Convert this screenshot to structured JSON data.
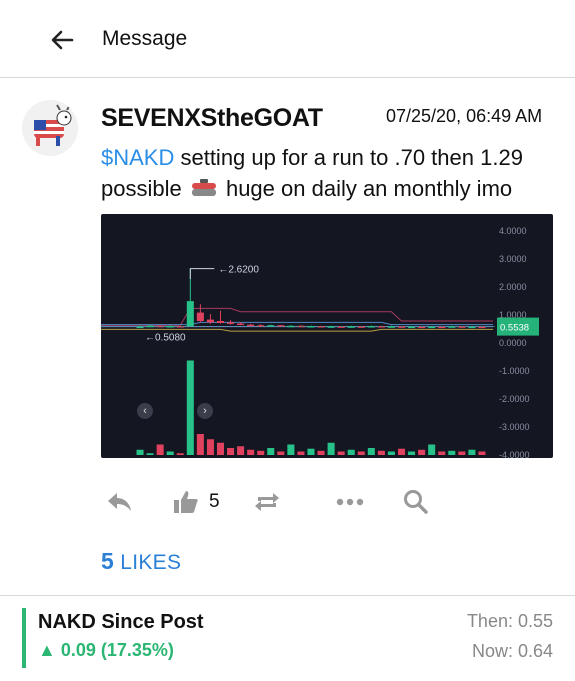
{
  "header": {
    "title": "Message"
  },
  "post": {
    "username": "SEVENXStheGOAT",
    "timestamp": "07/25/20, 06:49 AM",
    "ticker": "$NAKD",
    "text_a": " setting up for a run to .70 then 1.29 possible",
    "text_b": " huge on daily an monthly imo"
  },
  "chart_data": {
    "type": "candlestick",
    "y_ticks": [
      "4.0000",
      "3.0000",
      "2.0000",
      "1.0000",
      "0.0000",
      "-1.0000",
      "-2.0000",
      "-3.0000",
      "-4.0000"
    ],
    "high_label": "2.6200",
    "low_label": "0.5080",
    "last_price_label": "0.5538",
    "ylim": [
      -4,
      4
    ],
    "candles": [
      {
        "open": 0.52,
        "close": 0.55,
        "high": 0.58,
        "low": 0.5,
        "dir": "up"
      },
      {
        "open": 0.55,
        "close": 0.58,
        "high": 0.62,
        "low": 0.54,
        "dir": "up"
      },
      {
        "open": 0.58,
        "close": 0.56,
        "high": 0.6,
        "low": 0.53,
        "dir": "down"
      },
      {
        "open": 0.56,
        "close": 0.57,
        "high": 0.59,
        "low": 0.54,
        "dir": "up"
      },
      {
        "open": 0.57,
        "close": 0.56,
        "high": 0.58,
        "low": 0.54,
        "dir": "down"
      },
      {
        "open": 0.56,
        "close": 1.46,
        "high": 2.62,
        "low": 0.55,
        "dir": "up"
      },
      {
        "open": 1.05,
        "close": 0.75,
        "high": 1.35,
        "low": 0.7,
        "dir": "down"
      },
      {
        "open": 0.8,
        "close": 0.7,
        "high": 1.0,
        "low": 0.65,
        "dir": "down"
      },
      {
        "open": 0.75,
        "close": 0.68,
        "high": 1.12,
        "low": 0.66,
        "dir": "down"
      },
      {
        "open": 0.7,
        "close": 0.65,
        "high": 0.78,
        "low": 0.62,
        "dir": "down"
      },
      {
        "open": 0.66,
        "close": 0.62,
        "high": 0.7,
        "low": 0.6,
        "dir": "down"
      },
      {
        "open": 0.62,
        "close": 0.6,
        "high": 0.65,
        "low": 0.58,
        "dir": "down"
      },
      {
        "open": 0.6,
        "close": 0.58,
        "high": 0.63,
        "low": 0.56,
        "dir": "down"
      },
      {
        "open": 0.58,
        "close": 0.6,
        "high": 0.62,
        "low": 0.56,
        "dir": "up"
      },
      {
        "open": 0.6,
        "close": 0.57,
        "high": 0.61,
        "low": 0.55,
        "dir": "down"
      },
      {
        "open": 0.57,
        "close": 0.58,
        "high": 0.6,
        "low": 0.55,
        "dir": "up"
      },
      {
        "open": 0.58,
        "close": 0.56,
        "high": 0.6,
        "low": 0.54,
        "dir": "down"
      },
      {
        "open": 0.56,
        "close": 0.57,
        "high": 0.59,
        "low": 0.54,
        "dir": "up"
      },
      {
        "open": 0.57,
        "close": 0.55,
        "high": 0.58,
        "low": 0.53,
        "dir": "down"
      },
      {
        "open": 0.55,
        "close": 0.56,
        "high": 0.58,
        "low": 0.53,
        "dir": "up"
      },
      {
        "open": 0.56,
        "close": 0.54,
        "high": 0.57,
        "low": 0.52,
        "dir": "down"
      },
      {
        "open": 0.54,
        "close": 0.56,
        "high": 0.58,
        "low": 0.53,
        "dir": "up"
      },
      {
        "open": 0.56,
        "close": 0.55,
        "high": 0.57,
        "low": 0.53,
        "dir": "down"
      },
      {
        "open": 0.55,
        "close": 0.57,
        "high": 0.59,
        "low": 0.54,
        "dir": "up"
      },
      {
        "open": 0.57,
        "close": 0.55,
        "high": 0.58,
        "low": 0.53,
        "dir": "down"
      },
      {
        "open": 0.55,
        "close": 0.56,
        "high": 0.58,
        "low": 0.54,
        "dir": "up"
      },
      {
        "open": 0.56,
        "close": 0.54,
        "high": 0.57,
        "low": 0.52,
        "dir": "down"
      },
      {
        "open": 0.54,
        "close": 0.55,
        "high": 0.57,
        "low": 0.53,
        "dir": "up"
      },
      {
        "open": 0.55,
        "close": 0.53,
        "high": 0.56,
        "low": 0.51,
        "dir": "down"
      },
      {
        "open": 0.53,
        "close": 0.55,
        "high": 0.57,
        "low": 0.52,
        "dir": "up"
      },
      {
        "open": 0.55,
        "close": 0.54,
        "high": 0.56,
        "low": 0.52,
        "dir": "down"
      },
      {
        "open": 0.54,
        "close": 0.56,
        "high": 0.58,
        "low": 0.53,
        "dir": "up"
      },
      {
        "open": 0.56,
        "close": 0.54,
        "high": 0.57,
        "low": 0.53,
        "dir": "down"
      },
      {
        "open": 0.54,
        "close": 0.55,
        "high": 0.56,
        "low": 0.53,
        "dir": "up"
      },
      {
        "open": 0.55,
        "close": 0.54,
        "high": 0.56,
        "low": 0.53,
        "dir": "down"
      }
    ],
    "volume": [
      0.15,
      0.05,
      0.3,
      0.1,
      0.05,
      2.7,
      0.6,
      0.45,
      0.35,
      0.2,
      0.25,
      0.15,
      0.12,
      0.2,
      0.1,
      0.3,
      0.1,
      0.18,
      0.12,
      0.35,
      0.1,
      0.15,
      0.1,
      0.2,
      0.12,
      0.1,
      0.18,
      0.1,
      0.15,
      0.3,
      0.1,
      0.12,
      0.1,
      0.15,
      0.1
    ],
    "up_color": "#26c28a",
    "down_color": "#e0415e"
  },
  "actions": {
    "like_count": "5"
  },
  "likes": {
    "count": "5",
    "label": " LIKES"
  },
  "since_post": {
    "title": "NAKD Since Post",
    "change": "▲ 0.09 (17.35%)",
    "then": "Then: 0.55",
    "now": "Now: 0.64"
  },
  "colors": {
    "accent": "#2a8ee8",
    "positive": "#2bb673",
    "chart_bg": "#141622"
  },
  "icons": [
    "back-arrow-icon",
    "reply-icon",
    "thumbs-up-icon",
    "repost-icon",
    "more-icon",
    "search-icon",
    "curling-stone-icon"
  ]
}
